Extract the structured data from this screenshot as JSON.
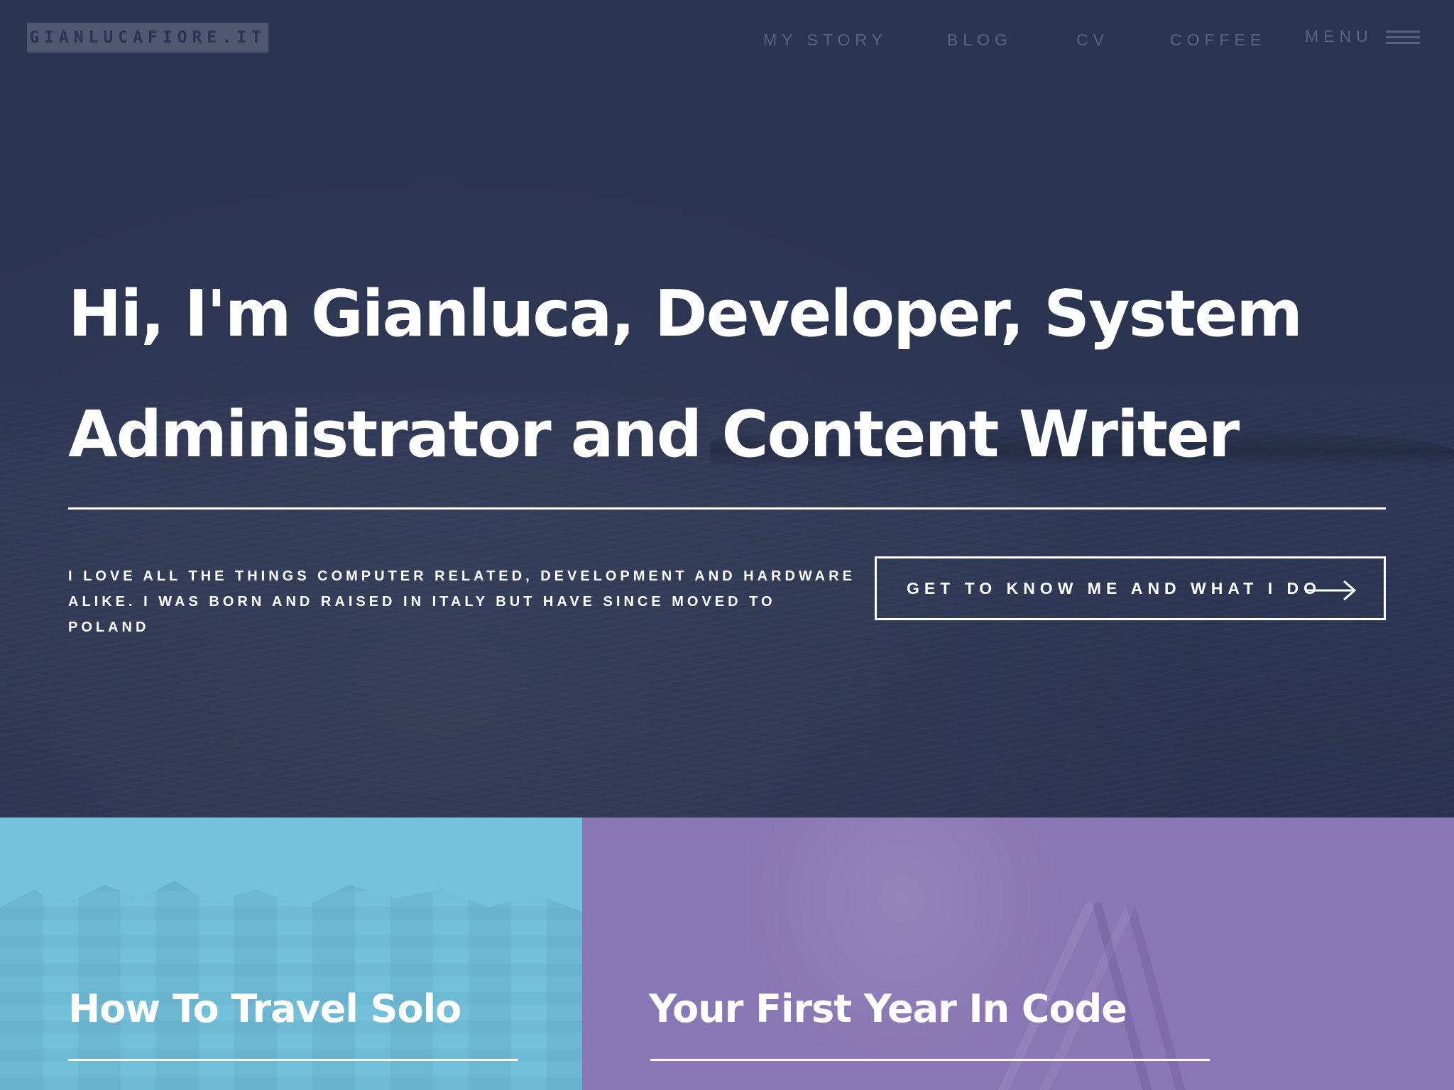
{
  "site": {
    "logo_text": "GIANLUCAFIORE.IT"
  },
  "nav": {
    "items": [
      {
        "label": "MY STORY"
      },
      {
        "label": "BLOG"
      },
      {
        "label": "CV"
      },
      {
        "label": "COFFEE"
      }
    ],
    "menu_label": "MENU",
    "menu_icon": "hamburger-menu-icon"
  },
  "hero": {
    "headline_line1": "Hi, I'm Gianluca, Developer, System",
    "headline_line2": "Administrator and Content Writer",
    "intro_line1": "I LOVE ALL THE THINGS COMPUTER RELATED, DEVELOPMENT AND HARDWARE",
    "intro_line2": "ALIKE. I WAS BORN AND RAISED IN ITALY BUT HAVE SINCE MOVED TO POLAND",
    "cta_label": "GET TO KNOW ME AND WHAT I DO",
    "cta_icon": "arrow-right-icon"
  },
  "cards": [
    {
      "title": "How To Travel Solo",
      "color": "#74c2dc"
    },
    {
      "title": "Your First Year In Code",
      "color": "#8976b4"
    }
  ],
  "colors": {
    "hero_background": "#2b3451",
    "nav_text": "#5b6380",
    "logo_background": "#4f5771",
    "text": "#ffffff"
  }
}
